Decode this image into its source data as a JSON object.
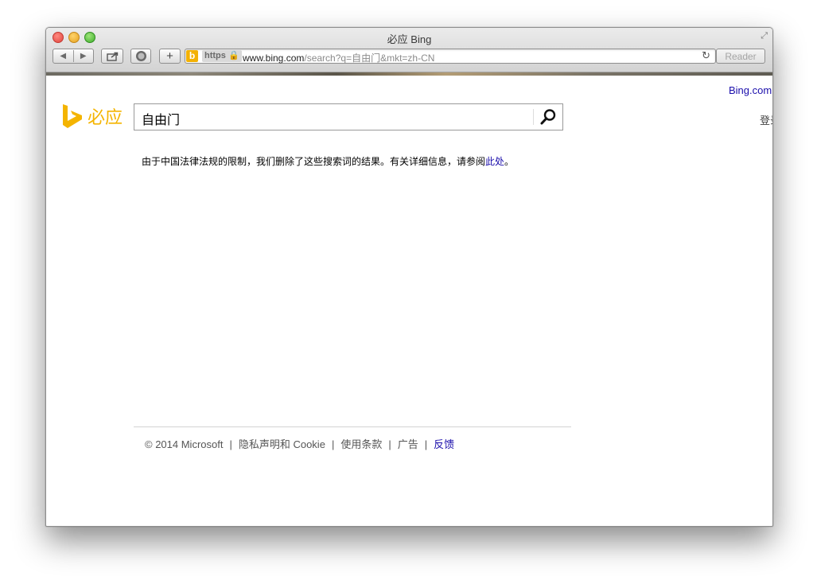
{
  "window": {
    "title": "必应 Bing"
  },
  "toolbar": {
    "back_label": "◀",
    "forward_label": "▶",
    "add_label": "+",
    "reader_label": "Reader"
  },
  "address": {
    "https_label": "https",
    "url_host": "www.bing.com",
    "url_rest": "/search?q=自由门&mkt=zh-CN",
    "reload_label": "C"
  },
  "page": {
    "top_link": "Bing.com",
    "signin_label": "登录",
    "logo_text": "必应",
    "search_query": "自由门",
    "notice_text": "由于中国法律法规的限制，我们删除了这些搜索词的结果。有关详细信息，请参阅",
    "notice_link": "此处",
    "notice_end": "。"
  },
  "footer": {
    "copyright": "© 2014 Microsoft",
    "privacy": "隐私声明和 Cookie",
    "terms": "使用条款",
    "ads": "广告",
    "feedback": "反馈",
    "separator": "|"
  },
  "colors": {
    "bing_orange": "#f4b400",
    "link_blue": "#1a0dab"
  }
}
